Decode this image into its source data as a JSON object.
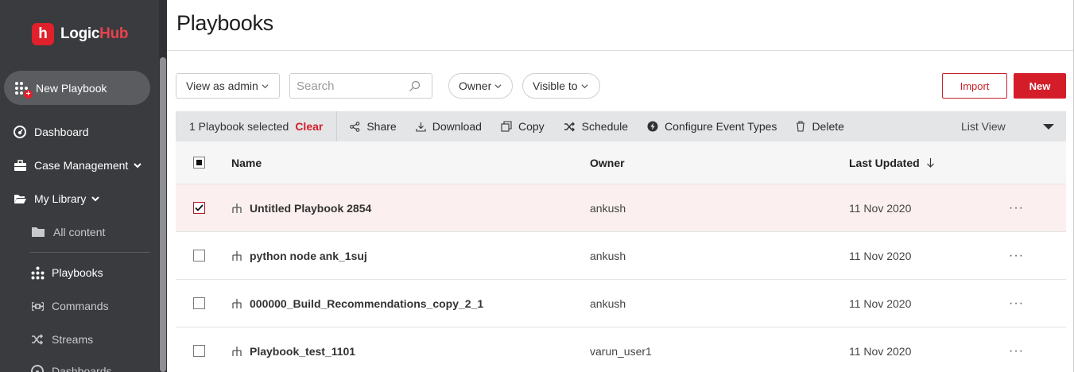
{
  "app": {
    "logo_mark": "h",
    "logo_text_a": "Logic",
    "logo_text_b": "Hub"
  },
  "sidebar": {
    "new_playbook": "New Playbook",
    "items": [
      {
        "label": "Dashboard",
        "icon": "dashboard-icon"
      },
      {
        "label": "Case Management",
        "icon": "briefcase-icon"
      },
      {
        "label": "My Library",
        "icon": "folder-open-icon"
      },
      {
        "label": "All content",
        "icon": "folder-icon"
      },
      {
        "label": "Playbooks",
        "icon": "playbook-icon"
      },
      {
        "label": "Commands",
        "icon": "command-icon"
      },
      {
        "label": "Streams",
        "icon": "shuffle-icon"
      },
      {
        "label": "Dashboards",
        "icon": "dashboard-icon"
      }
    ]
  },
  "page": {
    "title": "Playbooks"
  },
  "filters": {
    "view_as": "View as admin",
    "search_placeholder": "Search",
    "owner": "Owner",
    "visible_to": "Visible to"
  },
  "actions": {
    "import": "Import",
    "new": "New"
  },
  "toolbar": {
    "selected_text": "1 Playbook selected",
    "clear": "Clear",
    "share": "Share",
    "download": "Download",
    "copy": "Copy",
    "schedule": "Schedule",
    "configure": "Configure Event Types",
    "delete": "Delete",
    "list_view": "List View"
  },
  "table": {
    "headers": {
      "name": "Name",
      "owner": "Owner",
      "updated": "Last Updated"
    },
    "rows": [
      {
        "name": "Untitled Playbook 2854",
        "owner": "ankush",
        "updated": "11 Nov 2020",
        "selected": true
      },
      {
        "name": "python node ank_1suj",
        "owner": "ankush",
        "updated": "11 Nov 2020",
        "selected": false
      },
      {
        "name": "000000_Build_Recommendations_copy_2_1",
        "owner": "ankush",
        "updated": "11 Nov 2020",
        "selected": false
      },
      {
        "name": "Playbook_test_1101",
        "owner": "varun_user1",
        "updated": "11 Nov 2020",
        "selected": false
      }
    ],
    "more_glyph": "···"
  },
  "colors": {
    "brand": "#d31e2a",
    "sidebar_bg": "#393b3f",
    "selected_row": "#fbefef"
  }
}
